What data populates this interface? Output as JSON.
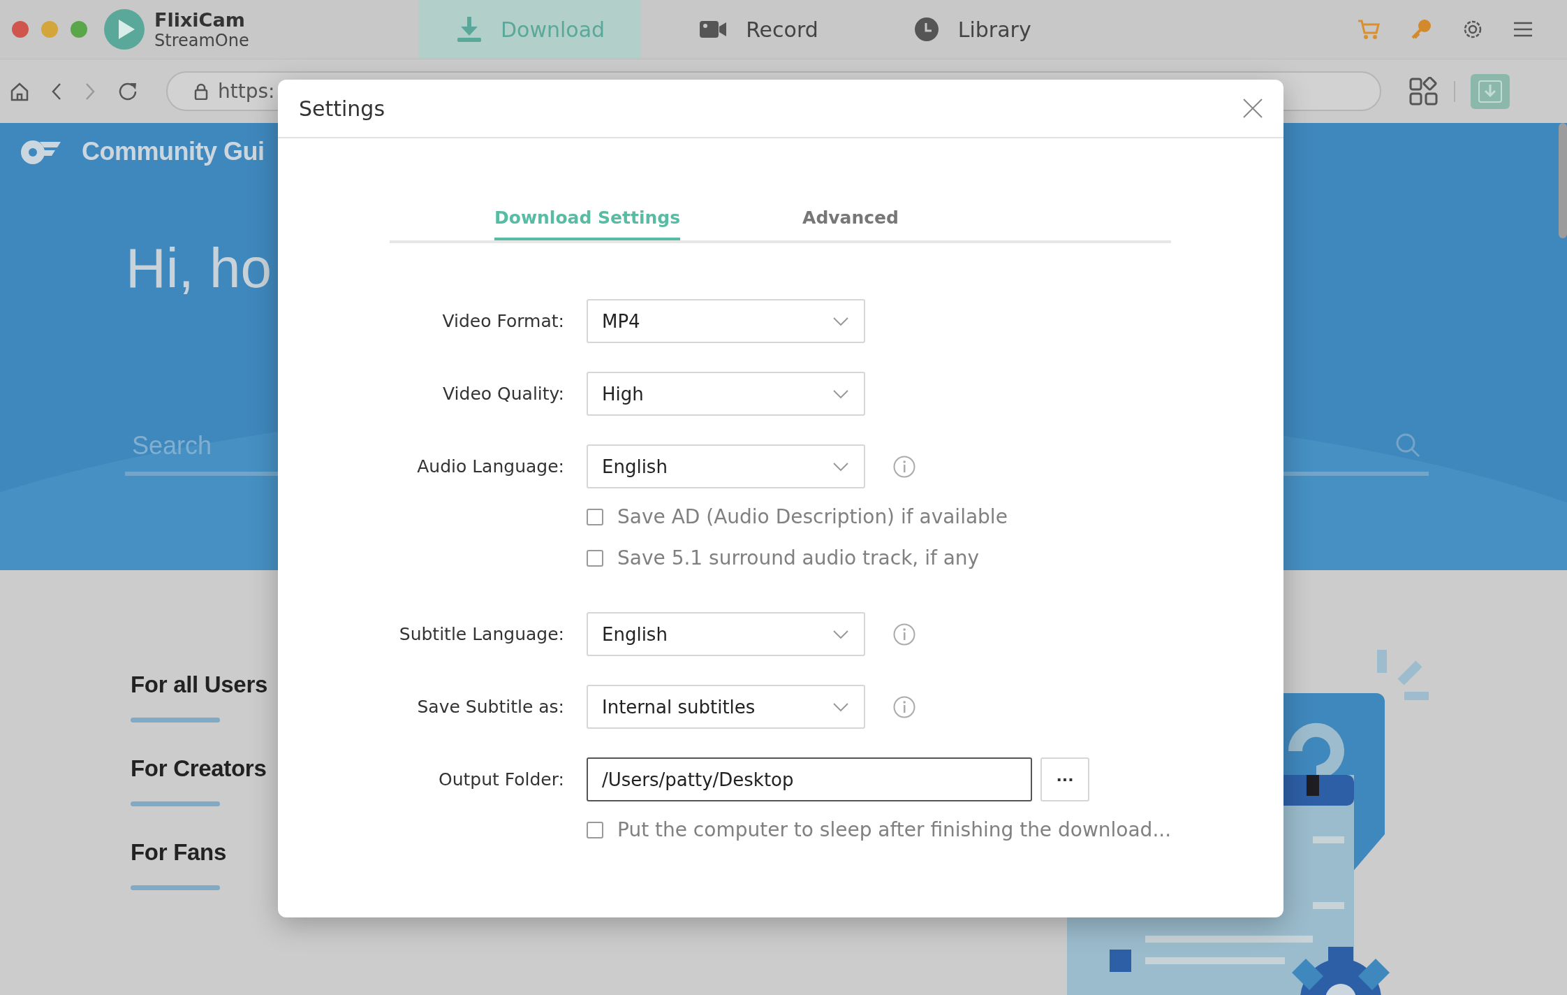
{
  "app": {
    "name": "FlixiCam",
    "edition": "StreamOne"
  },
  "nav_tabs": [
    {
      "label": "Download",
      "kind": "download",
      "selected": true
    },
    {
      "label": "Record",
      "kind": "record",
      "selected": false
    },
    {
      "label": "Library",
      "kind": "library",
      "selected": false
    }
  ],
  "toolbar": {
    "url": "https:"
  },
  "web_page": {
    "site_name": "Community Gui",
    "heading": "Hi, ho",
    "search": {
      "placeholder": "Search"
    },
    "categories": [
      "For all Users",
      "For Creators",
      "For Fans"
    ]
  },
  "dialog": {
    "title": "Settings",
    "tabs": [
      {
        "label": "Download Settings",
        "selected": true
      },
      {
        "label": "Advanced",
        "selected": false
      }
    ],
    "rows": [
      {
        "kind": "select",
        "label": "Video Format:",
        "value": "MP4",
        "info": false
      },
      {
        "kind": "select",
        "label": "Video Quality:",
        "value": "High",
        "info": false
      },
      {
        "kind": "select",
        "label": "Audio Language:",
        "value": "English",
        "info": true
      },
      {
        "kind": "checkbox",
        "label": "Save AD (Audio Description) if available",
        "checked": false
      },
      {
        "kind": "checkbox",
        "label": "Save 5.1 surround audio track, if any",
        "checked": false
      },
      {
        "kind": "select",
        "label": "Subtitle Language:",
        "value": "English",
        "info": true
      },
      {
        "kind": "select",
        "label": "Save Subtitle as:",
        "value": "Internal subtitles",
        "info": true
      },
      {
        "kind": "folder",
        "label": "Output Folder:",
        "value": "/Users/patty/Desktop",
        "button": "···"
      },
      {
        "kind": "checkbox",
        "label": "Put the computer to sleep after finishing the download...",
        "checked": false
      }
    ]
  }
}
